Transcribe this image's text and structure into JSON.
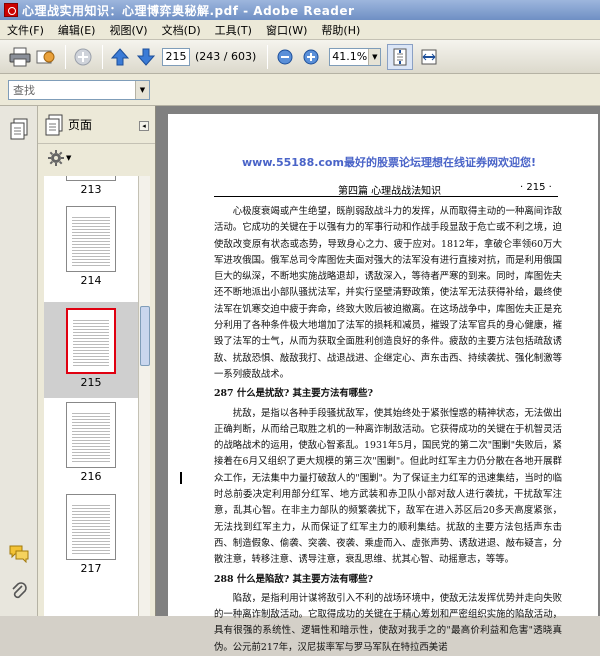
{
  "window": {
    "title": "心理战实用知识：心理博弈奥秘解.pdf - Adobe Reader"
  },
  "menubar": {
    "items": [
      "文件(F)",
      "编辑(E)",
      "视图(V)",
      "文档(D)",
      "工具(T)",
      "窗口(W)",
      "帮助(H)"
    ]
  },
  "toolbar": {
    "page_input": "215",
    "page_count": "(243 / 603)",
    "zoom": "41.1%"
  },
  "search": {
    "placeholder": "查找"
  },
  "panel": {
    "title": "页面",
    "thumbnails": [
      {
        "label": "213"
      },
      {
        "label": "214"
      },
      {
        "label": "215"
      },
      {
        "label": "216"
      },
      {
        "label": "217"
      }
    ]
  },
  "document": {
    "watermark": "www.55188.com最好的股票论坛理想在线证券网欢迎您!",
    "running_head": "第四篇  心理战战法知识",
    "page_number": "· 215 ·",
    "paragraph_1": "心极度衰竭或产生绝望，既削弱敌战斗力的发挥，从而取得主动的一种离间诈敌活动。它成功的关键在于以强有力的军事行动和作战手段显敌于危亡或不利之境，迫使敌改变原有状态或态势，导致身心之力、疲于应对。1812年，拿破仑率领60万大军进攻俄国。俄军总司令库图佐夫面对强大的法军没有进行直接对抗，而是利用俄国巨大的纵深，不断地实施战略退却，诱敌深入，等待者严寒的到来。同时，库图佐夫还不断地派出小部队骚扰法军，并实行坚壁清野政策，使法军无法获得补给，最终使法军在饥寒交迫中疲于奔命，终致大败后被迫撤离。在这场战争中，库图佐夫正是充分利用了各种条件极大地增加了法军的损耗和减员，摧毁了法军官兵的身心健康，摧毁了法军的士气，从而为获取全面胜利创造良好的条件。疲敌的主要方法包括疏敌诱敌、扰敌恐惧、敲敌我打、战退战进、企继定心、声东击西、持续袭扰、强化制激等一系列疲敌战术。",
    "heading_287": "287  什么是扰敌? 其主要方法有哪些?",
    "paragraph_2": "扰敌，是指以各种手段骚扰敌军，使其始终处于紧张惶惑的精神状态，无法做出正确判断，从而给己取胜之机的一种离诈制敌活动。它获得成功的关键在于机智灵活的战略战术的运用，使敌心智紊乱。1931年5月，国民党的第二次\"围剿\"失败后，紧接着在6月又组织了更大规模的第三次\"围剿\"。但此时红军主力仍分散在各地开展群众工作，无法集中力量打破敌人的\"围剿\"。为了保证主力红军的迅速集结，当时的临时总前委决定利用部分红军、地方武装和赤卫队小部对敌人进行袭扰，干扰敌军注意，乱其心智。在非主力部队的频繁袭扰下，敌军在进入苏区后20多天高度紧张，无法找到红军主力，从而保证了红军主力的顺利集结。扰敌的主要方法包括声东击西、制造假象、偷袭、突袭、夜袭、乘虚而入、虚张声势、诱敌进退、敲布疑言，分散注意，转移注意、诱导注意，衰乱思维、扰其心智、动摇意志，等等。",
    "heading_288": "288  什么是陷敌? 其主要方法有哪些?",
    "paragraph_3": "陷敌，是指利用计谋将敌引入不利的战场环境中，使敌无法发挥优势并走向失败的一种离诈制敌活动。它取得成功的关键在于精心筹划和严密组织实施的陷敌活动，具有很强的系统性、逻辑性和暗示性，使敌对我手之的\"最高价利益和危害\"透晓真伪。公元前217年，汉尼拔率军与罗马军队在特拉西美诺"
  }
}
